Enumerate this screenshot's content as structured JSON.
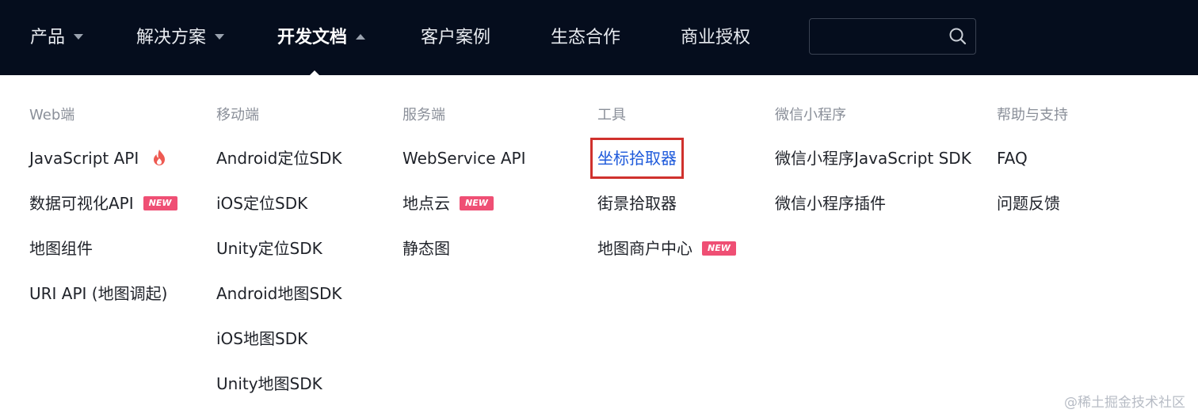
{
  "nav": {
    "items": [
      {
        "label": "产品",
        "caret": "down"
      },
      {
        "label": "解决方案",
        "caret": "down"
      },
      {
        "label": "开发文档",
        "caret": "up",
        "active": true
      },
      {
        "label": "客户案例"
      },
      {
        "label": "生态合作"
      },
      {
        "label": "商业授权"
      }
    ],
    "search": {
      "value": "",
      "placeholder": ""
    }
  },
  "menu": {
    "columns": [
      {
        "title": "Web端",
        "links": [
          {
            "label": "JavaScript API",
            "hot": true
          },
          {
            "label": "数据可视化API",
            "badge": "NEW"
          },
          {
            "label": "地图组件"
          },
          {
            "label": "URI API (地图调起)"
          }
        ]
      },
      {
        "title": "移动端",
        "links": [
          {
            "label": "Android定位SDK"
          },
          {
            "label": "iOS定位SDK"
          },
          {
            "label": "Unity定位SDK"
          },
          {
            "label": "Android地图SDK"
          },
          {
            "label": "iOS地图SDK"
          },
          {
            "label": "Unity地图SDK"
          }
        ]
      },
      {
        "title": "服务端",
        "links": [
          {
            "label": "WebService API"
          },
          {
            "label": "地点云",
            "badge": "NEW"
          },
          {
            "label": "静态图"
          }
        ]
      },
      {
        "title": "工具",
        "links": [
          {
            "label": "坐标拾取器",
            "highlighted": true
          },
          {
            "label": "街景拾取器"
          },
          {
            "label": "地图商户中心",
            "badge": "NEW"
          }
        ]
      },
      {
        "title": "微信小程序",
        "links": [
          {
            "label": "微信小程序JavaScript SDK"
          },
          {
            "label": "微信小程序插件"
          }
        ]
      },
      {
        "title": "帮助与支持",
        "links": [
          {
            "label": "FAQ"
          },
          {
            "label": "问题反馈"
          }
        ]
      }
    ]
  },
  "colors": {
    "topbar_bg": "#050d1d",
    "badge_new": "#ef4f74",
    "highlight_text": "#1e5adb",
    "highlight_border": "#d0312d"
  },
  "watermark": "@稀土掘金技术社区"
}
